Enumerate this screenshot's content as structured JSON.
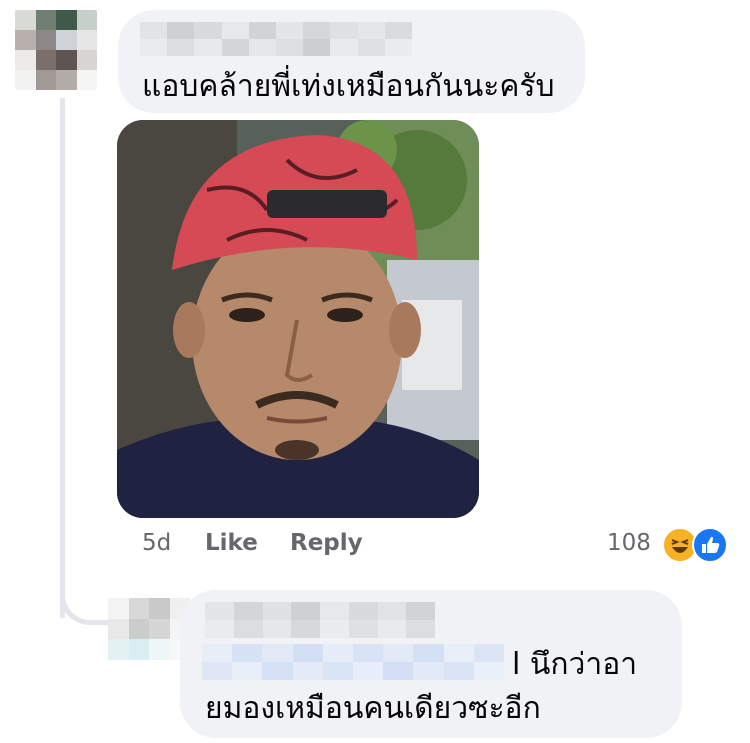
{
  "comment_1": {
    "text": "แอบคล้ายพี่เท่งเหมือนกันนะครับ",
    "time": "5d",
    "like_label": "Like",
    "reply_label": "Reply",
    "reaction_count": "108",
    "reactions": [
      "haha-icon",
      "like-icon"
    ]
  },
  "reply_1": {
    "text_line_1_suffix": "l นึกว่าอา",
    "text_line_2": "ยมองเหมือนคนเดียวซะอีก"
  },
  "colors": {
    "bubble": "#f0f2f5",
    "meta_text": "#65676b",
    "like_blue": "#1877f2",
    "haha_yellow": "#f7b125"
  }
}
